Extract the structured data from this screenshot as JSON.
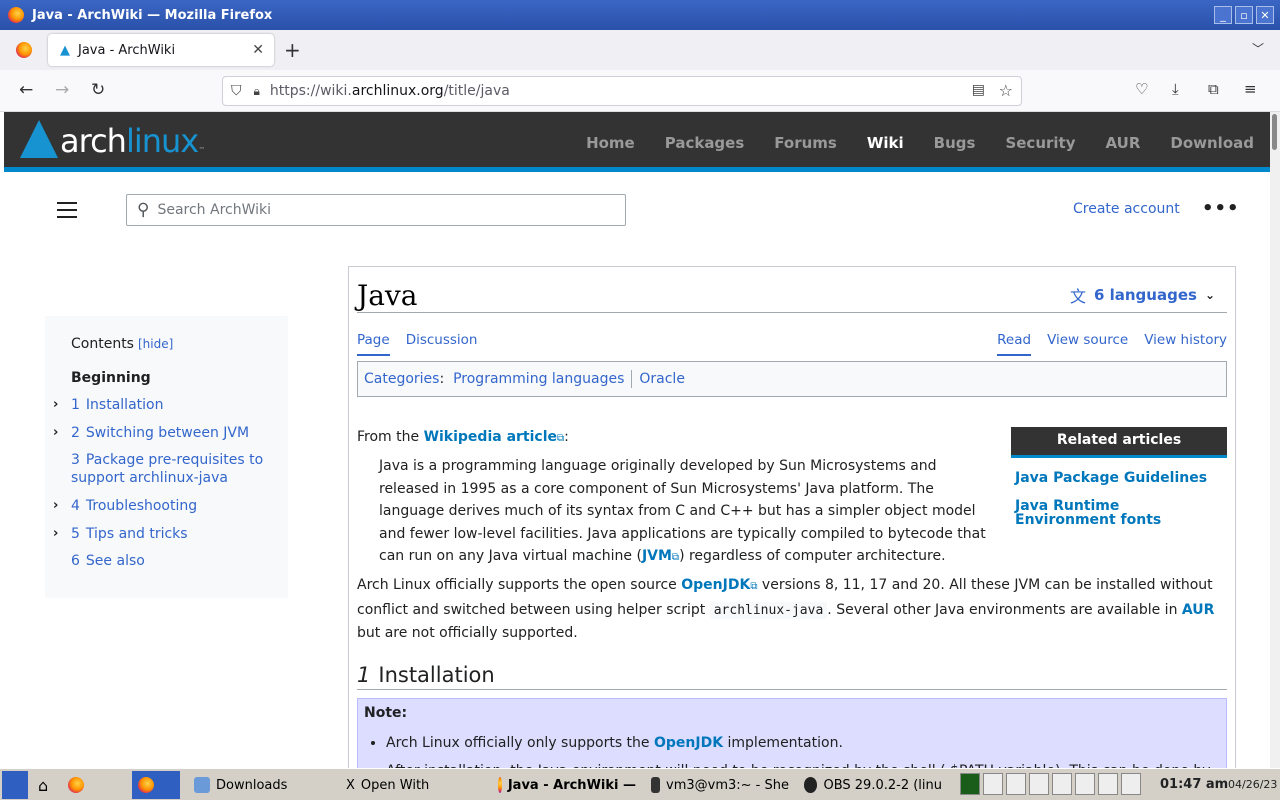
{
  "window": {
    "title": "Java - ArchWiki — Mozilla Firefox",
    "controls": [
      "_",
      "▫",
      "✕"
    ]
  },
  "tab": {
    "label": "Java - ArchWiki",
    "close": "✕",
    "new": "+",
    "list": "⌄"
  },
  "nav": {
    "back": "←",
    "forward": "→",
    "reload": "↻",
    "url_prefix": "https://wiki.",
    "url_domain": "archlinux.org",
    "url_path": "/title/java",
    "right_icons": [
      "pocket-icon",
      "download-icon",
      "extensions-icon",
      "menu-icon"
    ]
  },
  "arch": {
    "logo_arch": "arch",
    "logo_linux": "linux",
    "logo_tm": "™",
    "menu": [
      "Home",
      "Packages",
      "Forums",
      "Wiki",
      "Bugs",
      "Security",
      "AUR",
      "Download"
    ],
    "active": "Wiki",
    "accent": "#1793d1"
  },
  "wiki": {
    "search_placeholder": "Search ArchWiki",
    "create_account": "Create account",
    "more": "•••"
  },
  "toc": {
    "heading": "Contents",
    "hide": "[hide]",
    "beginning": "Beginning",
    "items": [
      {
        "num": "1",
        "label": "Installation",
        "expandable": true
      },
      {
        "num": "2",
        "label": "Switching between JVM",
        "expandable": true
      },
      {
        "num": "3",
        "label": "Package pre-requisites to",
        "label2": "support archlinux-java",
        "expandable": false
      },
      {
        "num": "4",
        "label": "Troubleshooting",
        "expandable": true
      },
      {
        "num": "5",
        "label": "Tips and tricks",
        "expandable": true
      },
      {
        "num": "6",
        "label": "See also",
        "expandable": false
      }
    ]
  },
  "page": {
    "title": "Java",
    "languages": "6 languages",
    "tabs_left": [
      "Page",
      "Discussion"
    ],
    "tabs_right": [
      "Read",
      "View source",
      "View history"
    ],
    "categories_label": "Categories",
    "categories": [
      "Programming languages",
      "Oracle"
    ],
    "related_heading": "Related articles",
    "related": [
      "Java Package Guidelines",
      "Java Runtime Environment fonts"
    ],
    "from_prefix": "From the ",
    "from_link": "Wikipedia article",
    "from_suffix": ":",
    "quote_1": "Java is a programming language originally developed by Sun Microsystems and released in 1995 as a core component of Sun Microsystems' Java platform. The language derives much of its syntax from C and C++ but has a simpler object model and fewer low-level facilities. Java applications are typically compiled to bytecode that can run on any Java virtual machine (",
    "quote_link": "JVM",
    "quote_2": ") regardless of computer architecture.",
    "para_1": "Arch Linux officially supports the open source ",
    "para_link": "OpenJDK",
    "para_2": " versions 8, 11, 17 and 20. All these JVM can be installed without conflict and switched between using helper script ",
    "para_code": "archlinux-java",
    "para_3": ". Several other Java environments are available in ",
    "para_aur": "AUR",
    "para_4": " but are not officially supported.",
    "h2_num": "1",
    "h2_title": "Installation",
    "note_title": "Note:",
    "note_1a": "Arch Linux officially only supports the ",
    "note_1link": "OpenJDK",
    "note_1b": " implementation.",
    "note_2": "After installation, the Java environment will need to be recognized by the shell ( $PATH variable). This can be done by"
  },
  "taskbar": {
    "items": [
      "Downloads",
      "Open With",
      "Java - ArchWiki —",
      "vm3@vm3:~ - She",
      "OBS 29.0.2-2 (linu"
    ],
    "time": "01:47 am",
    "date": "04/26/23"
  }
}
